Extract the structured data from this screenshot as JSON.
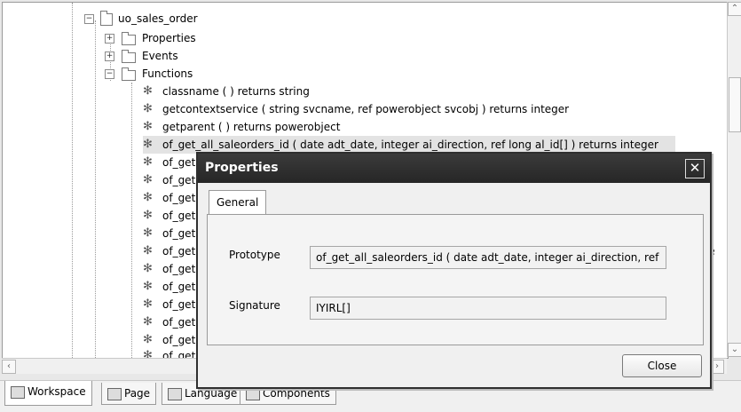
{
  "tree": {
    "root": "uo_sales_order",
    "nodes": [
      {
        "label": "Properties"
      },
      {
        "label": "Events"
      },
      {
        "label": "Functions"
      }
    ],
    "functions": [
      "classname ( ) returns string",
      "getcontextservice ( string svcname, ref powerobject svcobj ) returns integer",
      "getparent ( ) returns powerobject",
      "of_get_all_saleorders_id ( date adt_date, integer ai_direction, ref long al_id[] ) returns integer",
      "of_get",
      "of_get",
      "of_get",
      "of_get",
      "of_get",
      "of_get",
      "of_get",
      "of_get",
      "of_get",
      "of_get",
      "of_get",
      "of_get"
    ],
    "overflow_fragment": "nte"
  },
  "bottom_tabs": [
    {
      "label": "Workspace"
    },
    {
      "label": "Page"
    },
    {
      "label": "Language"
    },
    {
      "label": "Components"
    }
  ],
  "dialog": {
    "title": "Properties",
    "tab": "General",
    "prototype_label": "Prototype",
    "prototype_value": "of_get_all_saleorders_id ( date adt_date, integer ai_direction, ref",
    "signature_label": "Signature",
    "signature_value": "IYIRL[]",
    "close_label": "Close"
  },
  "icons": {
    "expand": "plus-icon",
    "collapse": "minus-icon",
    "folder": "folder-icon",
    "function": "gear-icon"
  }
}
